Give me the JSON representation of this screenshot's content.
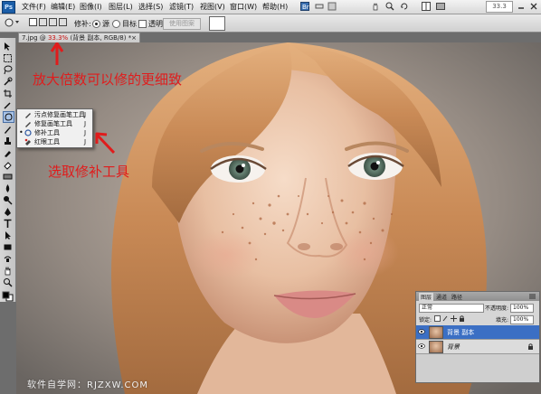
{
  "menubar": {
    "logo": "Ps",
    "items": [
      "文件(F)",
      "编辑(E)",
      "图像(I)",
      "图层(L)",
      "选择(S)",
      "滤镜(T)",
      "视图(V)",
      "窗口(W)",
      "帮助(H)"
    ],
    "zoom_value": "33.3"
  },
  "options": {
    "patch_label": "修补:",
    "source_label": "源",
    "destination_label": "目标",
    "transparent_label": "透明",
    "use_pattern_label": "使用图案"
  },
  "document": {
    "tab_prefix": "7.jpg @ ",
    "tab_zoom": "33.3%",
    "tab_suffix": " (背景 副本, RGB/8) *",
    "close_glyph": "×"
  },
  "flyout": {
    "items": [
      {
        "label": "污点修复画笔工具",
        "key": "J",
        "active": false
      },
      {
        "label": "修复画笔工具",
        "key": "J",
        "active": false
      },
      {
        "label": "修补工具",
        "key": "J",
        "active": true
      },
      {
        "label": "红眼工具",
        "key": "J",
        "active": false
      }
    ]
  },
  "annotations": {
    "zoom_tip": "放大倍数可以修的更细致",
    "tool_tip": "选取修补工具"
  },
  "layers_panel": {
    "tabs": [
      "图层",
      "通道",
      "路径"
    ],
    "blend_mode": "正常",
    "opacity_label": "不透明度:",
    "opacity_value": "100%",
    "lock_label": "锁定:",
    "fill_label": "填充:",
    "fill_value": "100%",
    "layers": [
      {
        "name": "背景 副本",
        "selected": true
      },
      {
        "name": "背景",
        "selected": false
      }
    ]
  },
  "watermark": "软件自学网：RJZXW.COM",
  "colors": {
    "annotation_red": "#e01c1c",
    "layer_selected": "#3b6fc4",
    "foreground": "#000000",
    "background": "#ffffff"
  }
}
